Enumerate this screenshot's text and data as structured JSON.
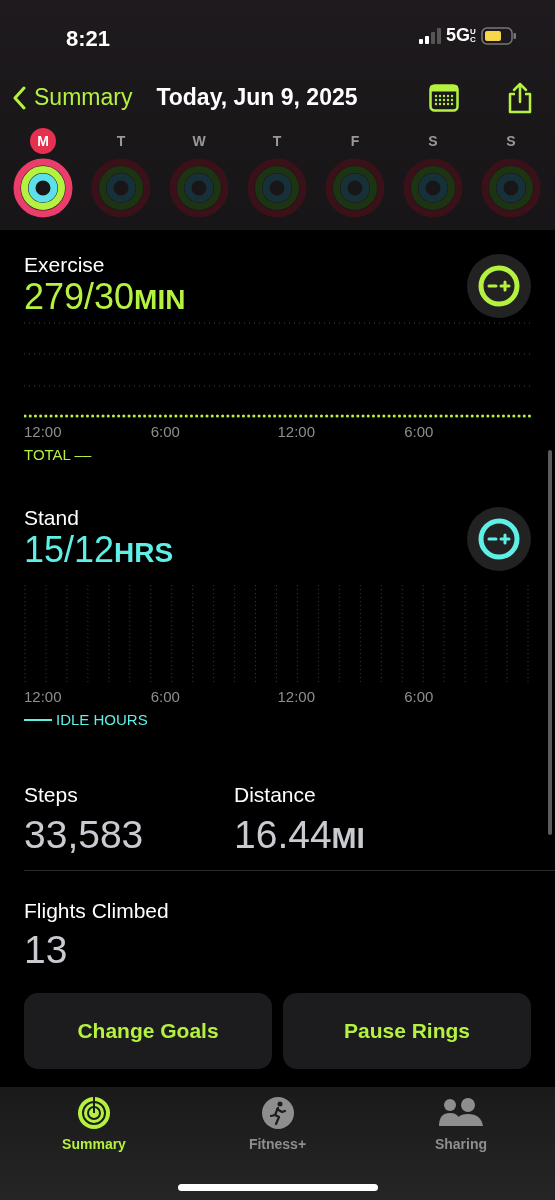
{
  "status_bar": {
    "time": "8:21",
    "network": "5G",
    "network_suffix": "UC"
  },
  "nav": {
    "back_label": "Summary",
    "title": "Today, Jun 9, 2025"
  },
  "week": [
    {
      "letter": "M",
      "selected": true,
      "rings_closed": true
    },
    {
      "letter": "T",
      "selected": false,
      "rings_closed": false
    },
    {
      "letter": "W",
      "selected": false,
      "rings_closed": false
    },
    {
      "letter": "T",
      "selected": false,
      "rings_closed": false
    },
    {
      "letter": "F",
      "selected": false,
      "rings_closed": false
    },
    {
      "letter": "S",
      "selected": false,
      "rings_closed": false
    },
    {
      "letter": "S",
      "selected": false,
      "rings_closed": false
    }
  ],
  "metrics": [
    {
      "kind": "exercise",
      "title": "Exercise",
      "value": "279/30",
      "unit": "MIN",
      "ticks": [
        "12:00",
        "6:00",
        "12:00",
        "6:00"
      ],
      "legend": "TOTAL ––"
    },
    {
      "kind": "stand",
      "title": "Stand",
      "value": "15/12",
      "unit": "HRS",
      "ticks": [
        "12:00",
        "6:00",
        "12:00",
        "6:00"
      ],
      "legend": "IDLE HOURS"
    }
  ],
  "stats": [
    {
      "label": "Steps",
      "value": "33,583"
    },
    {
      "label": "Distance",
      "value": "16.44",
      "unit": "MI"
    },
    {
      "label": "Flights Climbed",
      "value": "13"
    }
  ],
  "buttons": [
    "Change Goals",
    "Pause Rings"
  ],
  "tab_bar": [
    {
      "kind": "summary",
      "label": "Summary",
      "selected": true
    },
    {
      "kind": "fitness",
      "label": "Fitness+",
      "selected": false
    },
    {
      "kind": "sharing",
      "label": "Sharing",
      "selected": false
    }
  ]
}
